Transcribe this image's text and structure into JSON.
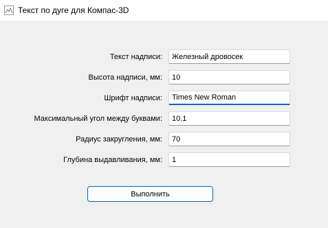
{
  "window": {
    "title": "Текст по дуге для Компас-3D",
    "icon": "app-window-icon"
  },
  "form": {
    "fields": [
      {
        "label": "Текст надписи:",
        "value": "Железный дровосек"
      },
      {
        "label": "Высота надписи, мм:",
        "value": "10"
      },
      {
        "label": "Шрифт надписи:",
        "value": "Times New Roman"
      },
      {
        "label": "Максимальный угол между буквами:",
        "value": "10.1"
      },
      {
        "label": "Радиус закругления, мм:",
        "value": "70"
      },
      {
        "label": "Глубина выдавливания, мм:",
        "value": "1"
      }
    ],
    "run_label": "Выполнить"
  },
  "colors": {
    "accent": "#0067c0",
    "background": "#f0f0f0"
  }
}
